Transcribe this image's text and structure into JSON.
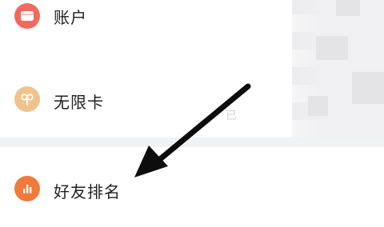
{
  "menu": {
    "items": [
      {
        "label": "账户",
        "icon": "wallet-icon",
        "color": "#f16a5f"
      },
      {
        "label": "无限卡",
        "icon": "infinity-card-icon",
        "color": "#f0c38d"
      },
      {
        "label": "好友排名",
        "icon": "bar-chart-icon",
        "color": "#f07a3b"
      }
    ]
  },
  "annotation": {
    "arrow_color": "#0d0d0d"
  },
  "blurred": {
    "ghost_text": "已"
  }
}
